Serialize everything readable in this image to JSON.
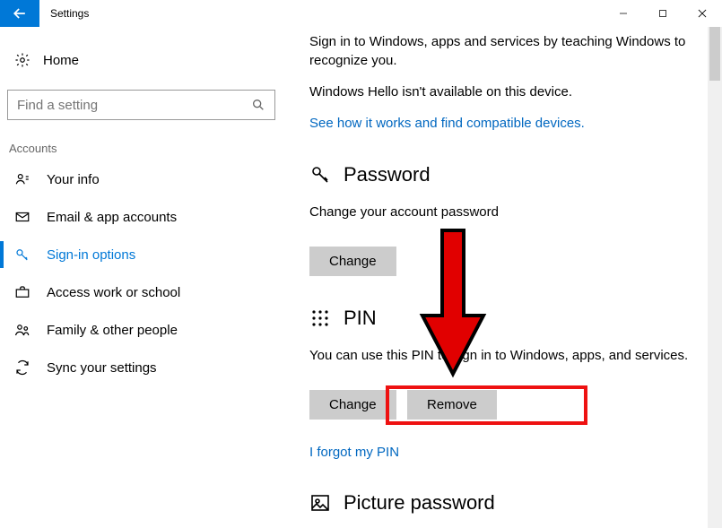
{
  "titlebar": {
    "title": "Settings"
  },
  "sidebar": {
    "home": "Home",
    "search_placeholder": "Find a setting",
    "category": "Accounts",
    "items": [
      {
        "label": "Your info"
      },
      {
        "label": "Email & app accounts"
      },
      {
        "label": "Sign-in options"
      },
      {
        "label": "Access work or school"
      },
      {
        "label": "Family & other people"
      },
      {
        "label": "Sync your settings"
      }
    ]
  },
  "content": {
    "intro_line": "Sign in to Windows, apps and services by teaching Windows to recognize you.",
    "hello_na": "Windows Hello isn't available on this device.",
    "hello_link": "See how it works and find compatible devices.",
    "password": {
      "title": "Password",
      "desc": "Change your account password",
      "change": "Change"
    },
    "pin": {
      "title": "PIN",
      "desc": "You can use this PIN to sign in to Windows, apps, and services.",
      "change": "Change",
      "remove": "Remove",
      "forgot": "I forgot my PIN"
    },
    "picture": {
      "title": "Picture password"
    }
  },
  "annotation": {
    "arrow_color": "#e10000"
  }
}
